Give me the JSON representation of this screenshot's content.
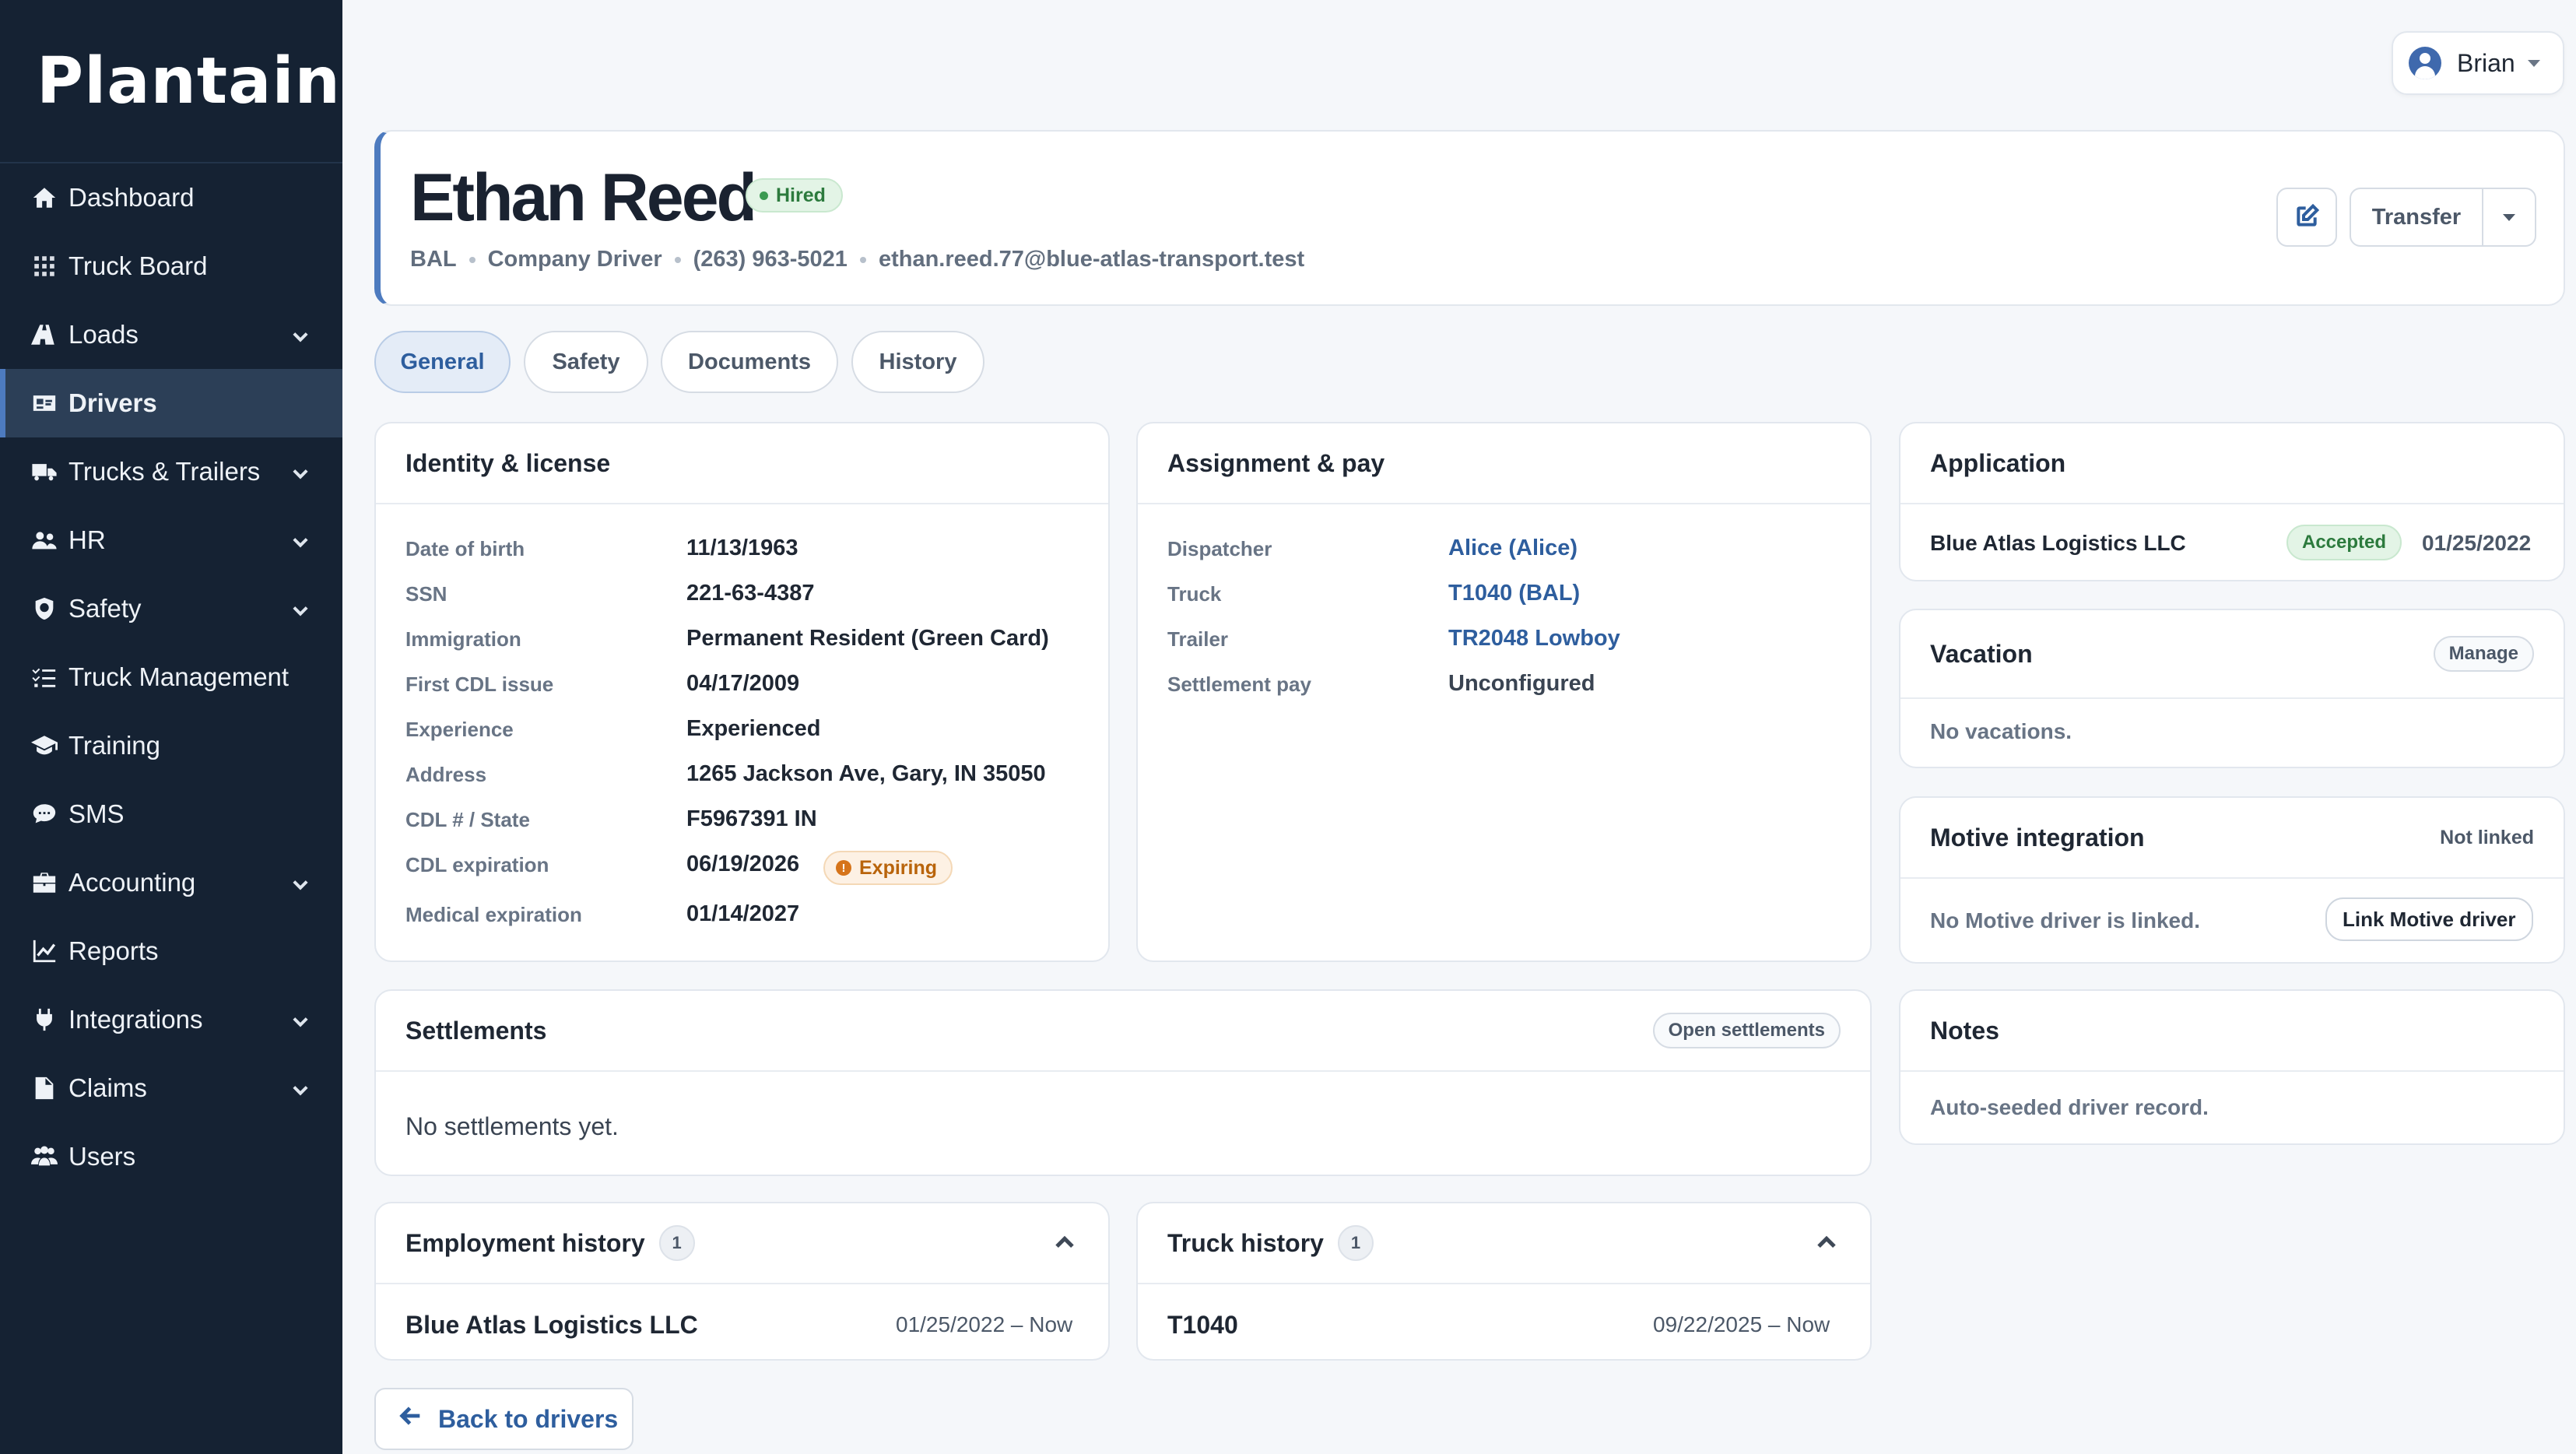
{
  "brand": "Plantain",
  "nav": [
    {
      "label": "Dashboard",
      "icon": "home-icon",
      "chevron": false,
      "active": false
    },
    {
      "label": "Truck Board",
      "icon": "grid-icon",
      "chevron": false,
      "active": false
    },
    {
      "label": "Loads",
      "icon": "road-icon",
      "chevron": true,
      "active": false
    },
    {
      "label": "Drivers",
      "icon": "id-card-icon",
      "chevron": false,
      "active": true
    },
    {
      "label": "Trucks & Trailers",
      "icon": "truck-icon",
      "chevron": true,
      "active": false
    },
    {
      "label": "HR",
      "icon": "people-icon",
      "chevron": true,
      "active": false
    },
    {
      "label": "Safety",
      "icon": "shield-icon",
      "chevron": true,
      "active": false
    },
    {
      "label": "Truck Management",
      "icon": "list-check-icon",
      "chevron": false,
      "active": false
    },
    {
      "label": "Training",
      "icon": "graduation-cap-icon",
      "chevron": false,
      "active": false
    },
    {
      "label": "SMS",
      "icon": "chat-icon",
      "chevron": false,
      "active": false
    },
    {
      "label": "Accounting",
      "icon": "briefcase-icon",
      "chevron": true,
      "active": false
    },
    {
      "label": "Reports",
      "icon": "chart-line-icon",
      "chevron": false,
      "active": false
    },
    {
      "label": "Integrations",
      "icon": "plug-icon",
      "chevron": true,
      "active": false
    },
    {
      "label": "Claims",
      "icon": "file-icon",
      "chevron": true,
      "active": false
    },
    {
      "label": "Users",
      "icon": "users-icon",
      "chevron": false,
      "active": false
    }
  ],
  "user": {
    "name": "Brian"
  },
  "driver": {
    "name": "Ethan Reed",
    "status": "Hired",
    "terminal": "BAL",
    "type": "Company Driver",
    "phone": "(263) 963-5021",
    "email": "ethan.reed.77@blue-atlas-transport.test"
  },
  "actions": {
    "transfer": "Transfer"
  },
  "tabs": [
    "General",
    "Safety",
    "Documents",
    "History"
  ],
  "identity": {
    "title": "Identity & license",
    "fields": [
      {
        "label": "Date of birth",
        "value": "11/13/1963"
      },
      {
        "label": "SSN",
        "value": "221-63-4387"
      },
      {
        "label": "Immigration",
        "value": "Permanent Resident (Green Card)"
      },
      {
        "label": "First CDL issue",
        "value": "04/17/2009"
      },
      {
        "label": "Experience",
        "value": "Experienced"
      },
      {
        "label": "Address",
        "value": "1265 Jackson Ave, Gary, IN 35050"
      },
      {
        "label": "CDL # / State",
        "value": "F5967391 IN"
      },
      {
        "label": "CDL expiration",
        "value": "06/19/2026"
      },
      {
        "label": "Medical expiration",
        "value": "01/14/2027"
      }
    ],
    "expiring_badge": "Expiring"
  },
  "assignment": {
    "title": "Assignment & pay",
    "fields": [
      {
        "label": "Dispatcher",
        "value": "Alice (Alice)"
      },
      {
        "label": "Truck",
        "value": "T1040 (BAL)"
      },
      {
        "label": "Trailer",
        "value": "TR2048 Lowboy"
      },
      {
        "label": "Settlement pay",
        "value": "Unconfigured"
      }
    ]
  },
  "application": {
    "title": "Application",
    "company": "Blue Atlas Logistics LLC",
    "status": "Accepted",
    "date": "01/25/2022"
  },
  "vacation": {
    "title": "Vacation",
    "manage": "Manage",
    "empty": "No vacations."
  },
  "motive": {
    "title": "Motive integration",
    "status": "Not linked",
    "empty": "No Motive driver is linked.",
    "link_button": "Link Motive driver"
  },
  "settlements": {
    "title": "Settlements",
    "open_button": "Open settlements",
    "empty": "No settlements yet."
  },
  "notes": {
    "title": "Notes",
    "text": "Auto-seeded driver record."
  },
  "employment_history": {
    "title": "Employment history",
    "count": "1",
    "company": "Blue Atlas Logistics LLC",
    "range": "01/25/2022 – Now"
  },
  "truck_history": {
    "title": "Truck history",
    "count": "1",
    "truck": "T1040",
    "range": "09/22/2025 – Now"
  },
  "back_button": "Back to drivers",
  "colors": {
    "sidebar": "#152233",
    "accent": "#2e5e9e",
    "hired": "#2c7a3d",
    "expiring": "#b9640b"
  }
}
